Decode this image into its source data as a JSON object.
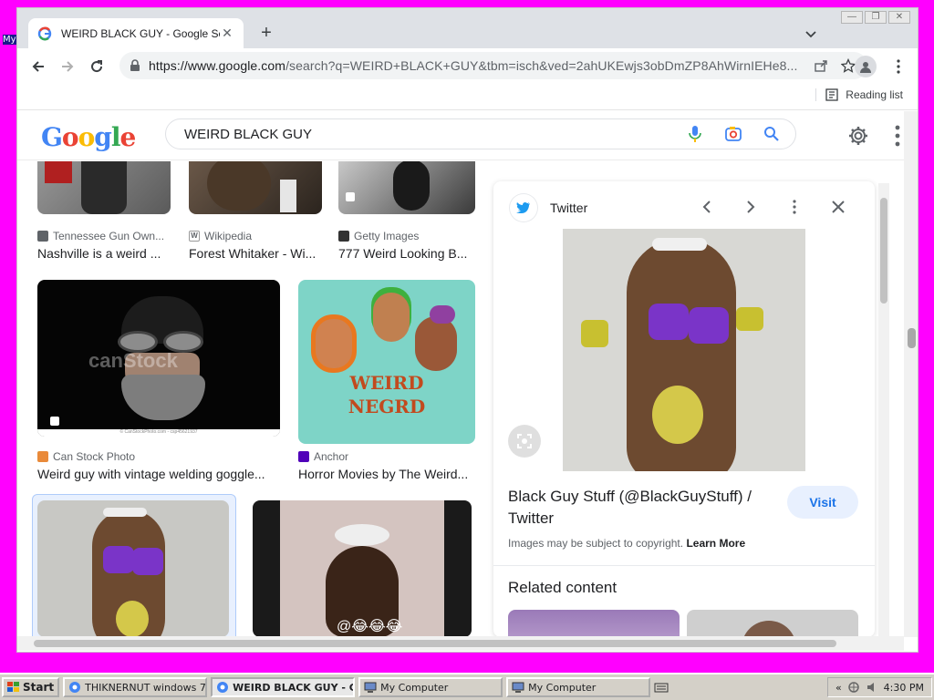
{
  "browser": {
    "tab_title": "WEIRD BLACK GUY - Google Search",
    "url_host": "https://www.google.com",
    "url_rest": "/search?q=WEIRD+BLACK+GUY&tbm=isch&ved=2ahUKEwjs3obDmZP8AhWirnIEHe8...",
    "reading_list": "Reading list"
  },
  "google": {
    "logo_letters": [
      "G",
      "o",
      "o",
      "g",
      "l",
      "e"
    ],
    "search_query": "WEIRD BLACK GUY"
  },
  "results": {
    "row1": [
      {
        "source": "Tennessee Gun Own...",
        "title": "Nashville is a weird ..."
      },
      {
        "source": "Wikipedia",
        "title": "Forest Whitaker - Wi..."
      },
      {
        "source": "Getty Images",
        "title": "777 Weird Looking B..."
      }
    ],
    "row2": [
      {
        "source": "Can Stock Photo",
        "title": "Weird guy with vintage welding goggle...",
        "watermark": "canStock",
        "caption": "© CanStockPhoto.com - csp45621937"
      },
      {
        "source": "Anchor",
        "title": "Horror Movies by The Weird...",
        "art_line1": "WEIRD",
        "art_line2": "NEGRD"
      }
    ],
    "row3_emoji": "@😂😂😂"
  },
  "panel": {
    "source": "Twitter",
    "title": "Black Guy Stuff (@BlackGuyStuff) / Twitter",
    "visit": "Visit",
    "copyright": "Images may be subject to copyright.",
    "learn_more": "Learn More",
    "related": "Related content"
  },
  "taskbar": {
    "start": "Start",
    "items": [
      {
        "label": "THIKNERNUT windows 7 ...",
        "active": false
      },
      {
        "label": "WEIRD BLACK GUY - G...",
        "active": true
      },
      {
        "label": "My Computer",
        "active": false
      },
      {
        "label": "My Computer",
        "active": false
      }
    ],
    "clock": "4:30 PM"
  },
  "colors": {
    "desktop": "#ff00ff",
    "google_blue": "#4285f4",
    "google_red": "#ea4335",
    "google_yellow": "#fbbc05",
    "google_green": "#34a853",
    "link_blue": "#1a73e8"
  }
}
